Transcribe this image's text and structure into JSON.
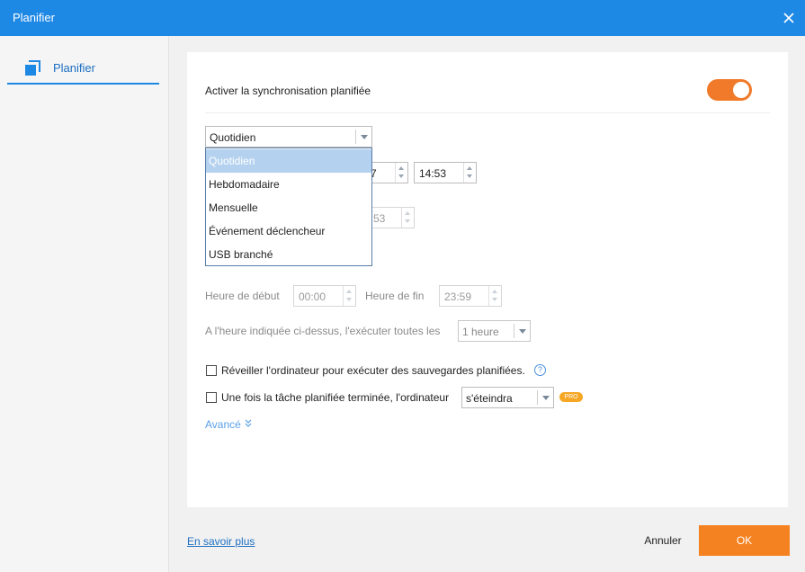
{
  "window": {
    "title": "Planifier"
  },
  "sidebar": {
    "items": [
      {
        "label": "Planifier",
        "icon": "copy-icon"
      }
    ]
  },
  "schedule": {
    "enable_label": "Activer la synchronisation planifiée",
    "enabled": true,
    "frequency": "Quotidien",
    "frequency_options": [
      "Quotidien",
      "Hebdomadaire",
      "Mensuelle",
      "Événement déclencheur",
      "USB branché"
    ],
    "time_partial": "7",
    "time": "14:53",
    "second_time_partial": "53",
    "start_label": "Heure de début",
    "start_value": "00:00",
    "end_label": "Heure de fin",
    "end_value": "23:59",
    "interval_label": "A l'heure indiquée ci-dessus, l'exécuter toutes les",
    "interval_value": "1 heure",
    "wake_label": "Réveiller l'ordinateur pour exécuter des sauvegardes planifiées.",
    "after_label": "Une fois la tâche planifiée terminée, l'ordinateur",
    "after_value": "s'éteindra",
    "pro_badge": "PRO",
    "advanced_label": "Avancé",
    "help_glyph": "?"
  },
  "footer": {
    "learn_more": "En savoir plus",
    "cancel": "Annuler",
    "ok": "OK"
  },
  "colors": {
    "titlebar": "#1e88e5",
    "accent": "#f58220",
    "toggle": "#f07a2a",
    "link": "#1d6fc2"
  }
}
